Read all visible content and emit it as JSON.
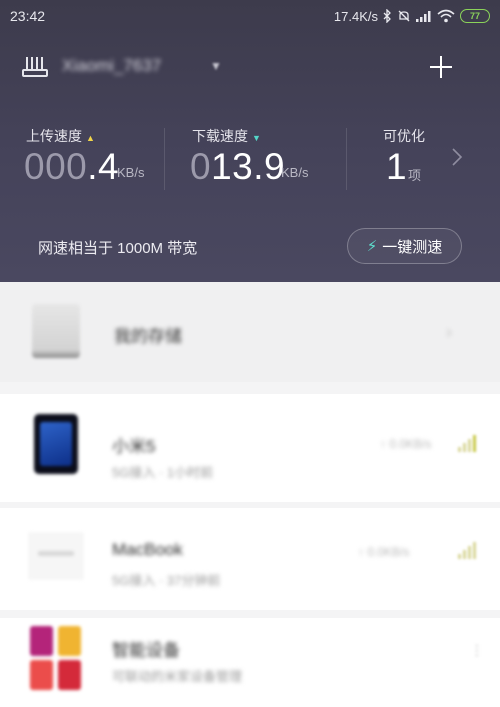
{
  "status_bar": {
    "time": "23:42",
    "net_speed": "17.4K/s",
    "battery": "77",
    "icons": [
      "bluetooth-icon",
      "silent-icon",
      "cell-signal-icon",
      "wifi-icon",
      "battery-icon"
    ]
  },
  "router": {
    "name": "Xiaomi_7637",
    "icon": "router-icon",
    "add_icon": "plus-icon"
  },
  "stats": {
    "upload": {
      "label": "上传速度",
      "value_dim": "000",
      "value_main": ".4",
      "unit": "KB/s"
    },
    "download": {
      "label": "下载速度",
      "value_dim": "0",
      "value_main": "13.9",
      "unit": "KB/s"
    },
    "optimize": {
      "label": "可优化",
      "value": "1",
      "unit": "项"
    }
  },
  "bandwidth": {
    "text": "网速相当于 1000M 带宽",
    "button_label": "一键测速"
  },
  "storage": {
    "label": "我的存储"
  },
  "devices": [
    {
      "name": "小米5",
      "sub": "5G接入 · 1小时前",
      "speed": "↑ 0.0KB/s"
    },
    {
      "name": "MacBook",
      "sub": "5G接入 · 37分钟前",
      "speed": "↑ 0.0KB/s"
    },
    {
      "name": "智能设备",
      "sub": "可联动的米家设备管理"
    }
  ],
  "colors": {
    "header_bg": "#45435a",
    "accent_teal": "#54d6c8",
    "accent_yellow": "#f2d64a",
    "battery_green": "#8bd35a"
  }
}
